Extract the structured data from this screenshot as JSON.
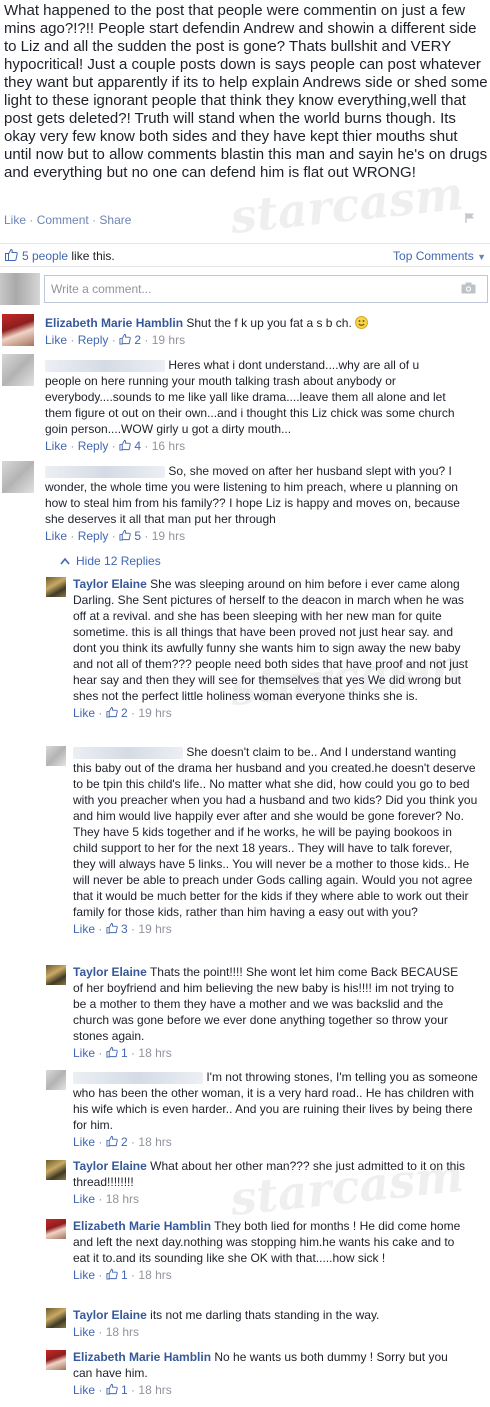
{
  "post": {
    "text": "What happened to the post that people were commentin on just a few mins ago?!?!! People start defendin Andrew and showin a different side to Liz and all the sudden the post is gone? Thats bullshit and VERY hypocritical! Just a couple posts down is says people can post whatever they want but apparently if its to help explain Andrews side or shed some light to these ignorant people that think they know everything,well that post gets deleted?! Truth will stand when the world burns though. Its okay very few know both sides and they have kept thier mouths shut until now but to allow comments blastin this man and sayin he's on drugs and everything but no one can defend him is flat out WRONG!",
    "actions": {
      "like": "Like",
      "comment": "Comment",
      "share": "Share",
      "separator": "·"
    }
  },
  "likes_bar": {
    "likes_text": "5 people",
    "likes_suffix": "like this.",
    "top_comments": "Top Comments"
  },
  "composer": {
    "placeholder": "Write a comment..."
  },
  "watermark": "starcasm",
  "comments": [
    {
      "author": "Elizabeth Marie Hamblin",
      "text": "Shut the f  k up you fat a  s b  ch.",
      "like": "Like",
      "reply": "Reply",
      "likes": "2",
      "time": "19 hrs"
    },
    {
      "author": "",
      "text": "Heres what i dont understand....why are all of u people on here running your mouth talking trash about anybody or everybody....sounds to me like yall like drama....leave them all alone and let them figure ot out on their own...and i thought this Liz chick was some church goin person....WOW girly u got a dirty mouth...",
      "like": "Like",
      "reply": "Reply",
      "likes": "4",
      "time": "16 hrs"
    },
    {
      "author": "",
      "text": "So, she moved on after her husband slept with you? I wonder, the whole time you were listening to him preach, where u planning on how to steal him from his family?? I hope Liz is happy and moves on, because she deserves it all that man put her through",
      "like": "Like",
      "reply": "Reply",
      "likes": "5",
      "time": "19 hrs"
    }
  ],
  "hide_replies": "Hide 12 Replies",
  "replies": [
    {
      "author": "Taylor Elaine",
      "text": "She was sleeping around on him before i ever came along Darling. She Sent pictures of herself to the deacon in march when he was off at a revival. and she has been sleeping with her new man for quite sometime. this is all things that have been proved not just hear say. and dont you think its awfully funny she wants him to sign away the new baby and not all of them??? people need both sides that have proof and not just hear say and then they will see for themselves that yes We did wrong but shes not the perfect little holiness woman everyone thinks she is.",
      "like": "Like",
      "likes": "2",
      "time": "19 hrs"
    },
    {
      "author": "",
      "text": "She doesn't claim to be.. And I understand wanting this baby out of the drama her husband and you created.he doesn't deserve to be tpin this child's life.. No matter what she did, how could you go to bed with you preacher when you had a husband and two kids? Did you think you and him would live happily ever after and she would be gone forever? No. They have 5 kids together and if he works, he will be paying bookoos in child support to her for the next 18 years.. They will have to talk forever, they will always have 5 links.. You will never be a mother to those kids.. He will never be able to preach under Gods calling again. Would you not agree that it would be much better for the kids if they where able to work out their family for those kids, rather than him having a easy out with you?",
      "like": "Like",
      "likes": "3",
      "time": "19 hrs"
    },
    {
      "author": "Taylor Elaine",
      "text": "Thats the point!!!! She wont let him come Back BECAUSE of her boyfriend and him believing the new baby is his!!!! im not trying to be a mother to them they have a mother and we was backslid and the church was gone before we ever done anything together so throw your stones again.",
      "like": "Like",
      "likes": "1",
      "time": "18 hrs"
    },
    {
      "author": "",
      "text": "I'm not throwing stones, I'm telling you as someone who has been the other woman, it is a very hard road.. He has children with his wife which is even harder.. And you are ruining their lives by being there for him.",
      "like": "Like",
      "likes": "2",
      "time": "18 hrs"
    },
    {
      "author": "Taylor Elaine",
      "text": "What about her other man??? she just admitted to it on this thread!!!!!!!!",
      "like": "Like",
      "likes": "",
      "time": "18 hrs"
    },
    {
      "author": "Elizabeth Marie Hamblin",
      "text": "They both lied for months ! He did come home and left the next day.nothing was stopping him.he wants his cake and to eat it to.and its sounding like she OK with that.....how sick !",
      "like": "Like",
      "likes": "1",
      "time": "18 hrs"
    },
    {
      "author": "Taylor Elaine",
      "text": "its not me darling thats standing in the way.",
      "like": "Like",
      "likes": "",
      "time": "18 hrs"
    },
    {
      "author": "Elizabeth Marie Hamblin",
      "text": "No he wants us both dummy ! Sorry but you can have him.",
      "like": "Like",
      "likes": "1",
      "time": "18 hrs"
    }
  ],
  "colors": {
    "link": "#4267b2",
    "author": "#365899",
    "meta": "#90949c",
    "text": "#1d2129"
  }
}
